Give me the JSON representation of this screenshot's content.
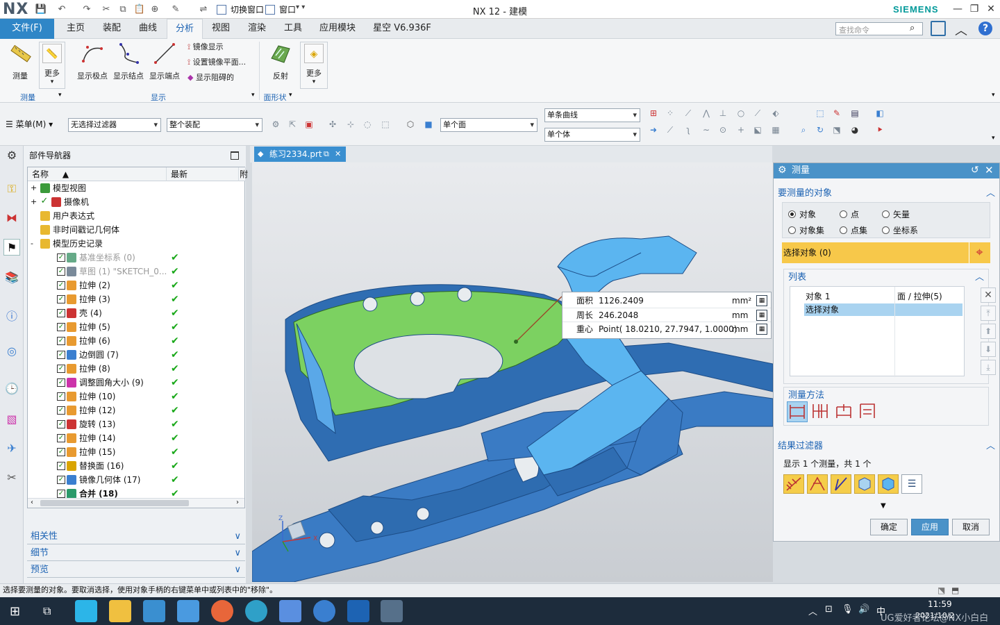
{
  "app": {
    "logo": "NX",
    "title": "NX 12 - 建模",
    "brand": "SIEMENS",
    "brand_color": "#009999",
    "accent": "#2f86c7"
  },
  "quick_access": {
    "switch_window": "切换窗口",
    "window": "窗口"
  },
  "menu": {
    "file": "文件(F)",
    "tabs": [
      "主页",
      "装配",
      "曲线",
      "分析",
      "视图",
      "渲染",
      "工具",
      "应用模块",
      "星空 V6.936F"
    ],
    "active_tab": "分析",
    "search_placeholder": "查找命令"
  },
  "ribbon": {
    "measure": "测量",
    "more1": "更多",
    "show_poles": "显示极点",
    "show_knots": "显示结点",
    "show_endpoints": "显示端点",
    "mirror_display": "镜像显示",
    "set_mirror_plane": "设置镜像平面...",
    "show_obstruction": "显示阻碍的",
    "reflection": "反射",
    "more2": "更多",
    "group_measure": "测量",
    "group_display": "显示",
    "group_face_shape": "面形状"
  },
  "toolbar2": {
    "menu": "菜单(M)",
    "filter": "无选择过滤器",
    "assembly": "整个装配",
    "single_face": "单个面",
    "single_curve": "单条曲线",
    "single_body": "单个体"
  },
  "navigator": {
    "title": "部件导航器",
    "col_name": "名称",
    "col_latest": "最新",
    "col_extra": "附",
    "rows": [
      {
        "label": "模型视图"
      },
      {
        "label": "摄像机"
      },
      {
        "label": "用户表达式"
      },
      {
        "label": "非时间戳记几何体"
      },
      {
        "label": "模型历史记录"
      },
      {
        "label": "基准坐标系 (0)"
      },
      {
        "label": "草图 (1) \"SKETCH_0..."
      },
      {
        "label": "拉伸 (2)"
      },
      {
        "label": "拉伸 (3)"
      },
      {
        "label": "壳 (4)"
      },
      {
        "label": "拉伸 (5)"
      },
      {
        "label": "拉伸 (6)"
      },
      {
        "label": "边倒圆 (7)"
      },
      {
        "label": "拉伸 (8)"
      },
      {
        "label": "调整圆角大小 (9)"
      },
      {
        "label": "拉伸 (10)"
      },
      {
        "label": "拉伸 (12)"
      },
      {
        "label": "旋转 (13)"
      },
      {
        "label": "拉伸 (14)"
      },
      {
        "label": "拉伸 (15)"
      },
      {
        "label": "替换面 (16)"
      },
      {
        "label": "镜像几何体 (17)"
      },
      {
        "label": "合并 (18)"
      }
    ],
    "dependencies": "相关性",
    "details": "细节",
    "preview": "预览"
  },
  "graphics": {
    "file_tab": "练习2334.prt"
  },
  "measure_result": {
    "area_label": "面积",
    "area_value": "1126.2409",
    "area_unit": "mm²",
    "perimeter_label": "周长",
    "perimeter_value": "246.2048",
    "perimeter_unit": "mm",
    "centroid_label": "重心",
    "centroid_value": "Point( 18.0210, 27.7947, 1.0000)",
    "centroid_unit": "mm"
  },
  "dialog": {
    "title": "测量",
    "objects_section": "要测量的对象",
    "radio_object": "对象",
    "radio_point": "点",
    "radio_vector": "矢量",
    "radio_object_set": "对象集",
    "radio_point_set": "点集",
    "radio_csys": "坐标系",
    "select_object": "选择对象 (0)",
    "list_section": "列表",
    "list_row1_name": "对象 1",
    "list_row1_value": "面 / 拉伸(5)",
    "list_row2_name": "选择对象",
    "method_section": "测量方法",
    "result_filter_section": "结果过滤器",
    "result_count": "显示 1 个测量，共 1 个",
    "ok": "确定",
    "apply": "应用",
    "cancel": "取消"
  },
  "status": {
    "message": "选择要测量的对象。要取消选择，使用对象手柄的右键菜单中或列表中的\"移除\"。"
  },
  "taskbar": {
    "time": "11:59",
    "date": "2021/10/2",
    "ime": "中",
    "watermark": "UG爱好者论坛@NX小白白"
  }
}
